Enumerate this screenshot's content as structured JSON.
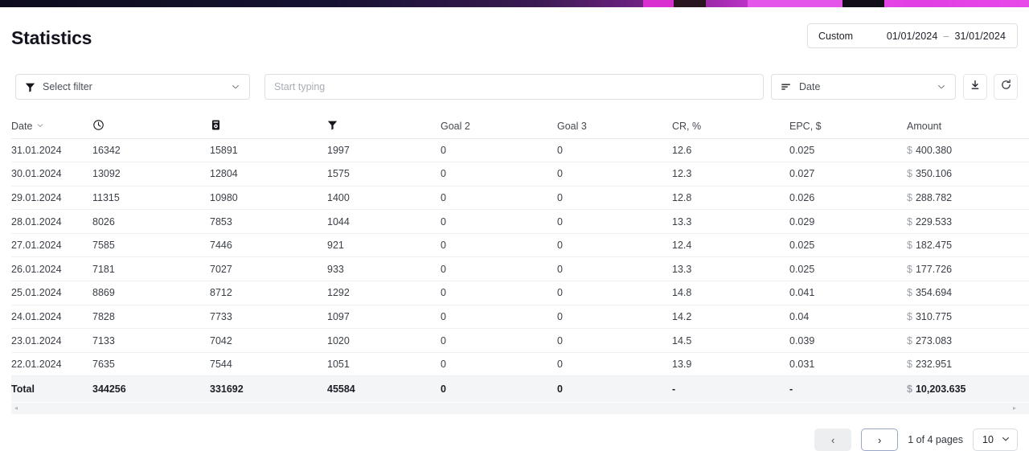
{
  "topbar": {
    "accent_dark": "#0d0c1d",
    "accent_magenta": "#e84ae8"
  },
  "header": {
    "title": "Statistics",
    "date_range": {
      "preset_label": "Custom",
      "start_date": "01/01/2024",
      "separator": "–",
      "end_date": "31/01/2024"
    }
  },
  "toolbar": {
    "filter_select": {
      "icon": "funnel-icon",
      "label": "Select filter",
      "caret": "chevron-down-icon"
    },
    "search": {
      "value": "",
      "placeholder": "Start typing"
    },
    "sort_select": {
      "icon": "sort-lines-icon",
      "label": "Date",
      "caret": "chevron-down-icon"
    },
    "export_button": {
      "icon": "download-icon"
    },
    "refresh_button": {
      "icon": "refresh-icon"
    }
  },
  "table": {
    "columns": [
      {
        "key": "date",
        "label": "Date",
        "icon": "",
        "sortable": true,
        "sort_caret": "⌄",
        "align": "left"
      },
      {
        "key": "clicks",
        "label": "",
        "icon": "clock-icon",
        "sortable": false,
        "align": "left"
      },
      {
        "key": "unique",
        "label": "",
        "icon": "document-eye-icon",
        "sortable": false,
        "align": "left"
      },
      {
        "key": "goal1",
        "label": "",
        "icon": "funnel-icon",
        "sortable": false,
        "align": "left"
      },
      {
        "key": "goal2",
        "label": "Goal 2",
        "icon": "",
        "sortable": false,
        "align": "left"
      },
      {
        "key": "goal3",
        "label": "Goal 3",
        "icon": "",
        "sortable": false,
        "align": "left"
      },
      {
        "key": "cr",
        "label": "CR, %",
        "icon": "",
        "sortable": false,
        "align": "left"
      },
      {
        "key": "epc",
        "label": "EPC, $",
        "icon": "",
        "sortable": false,
        "align": "left"
      },
      {
        "key": "amount",
        "label": "Amount",
        "icon": "",
        "sortable": false,
        "align": "left"
      }
    ],
    "rows": [
      {
        "date": "31.01.2024",
        "clicks": "16342",
        "unique": "15891",
        "goal1": "1997",
        "goal2": "0",
        "goal3": "0",
        "cr": "12.6",
        "epc": "0.025",
        "amount_currency": "$",
        "amount": "400.380"
      },
      {
        "date": "30.01.2024",
        "clicks": "13092",
        "unique": "12804",
        "goal1": "1575",
        "goal2": "0",
        "goal3": "0",
        "cr": "12.3",
        "epc": "0.027",
        "amount_currency": "$",
        "amount": "350.106"
      },
      {
        "date": "29.01.2024",
        "clicks": "11315",
        "unique": "10980",
        "goal1": "1400",
        "goal2": "0",
        "goal3": "0",
        "cr": "12.8",
        "epc": "0.026",
        "amount_currency": "$",
        "amount": "288.782"
      },
      {
        "date": "28.01.2024",
        "clicks": "8026",
        "unique": "7853",
        "goal1": "1044",
        "goal2": "0",
        "goal3": "0",
        "cr": "13.3",
        "epc": "0.029",
        "amount_currency": "$",
        "amount": "229.533"
      },
      {
        "date": "27.01.2024",
        "clicks": "7585",
        "unique": "7446",
        "goal1": "921",
        "goal2": "0",
        "goal3": "0",
        "cr": "12.4",
        "epc": "0.025",
        "amount_currency": "$",
        "amount": "182.475"
      },
      {
        "date": "26.01.2024",
        "clicks": "7181",
        "unique": "7027",
        "goal1": "933",
        "goal2": "0",
        "goal3": "0",
        "cr": "13.3",
        "epc": "0.025",
        "amount_currency": "$",
        "amount": "177.726"
      },
      {
        "date": "25.01.2024",
        "clicks": "8869",
        "unique": "8712",
        "goal1": "1292",
        "goal2": "0",
        "goal3": "0",
        "cr": "14.8",
        "epc": "0.041",
        "amount_currency": "$",
        "amount": "354.694"
      },
      {
        "date": "24.01.2024",
        "clicks": "7828",
        "unique": "7733",
        "goal1": "1097",
        "goal2": "0",
        "goal3": "0",
        "cr": "14.2",
        "epc": "0.04",
        "amount_currency": "$",
        "amount": "310.775"
      },
      {
        "date": "23.01.2024",
        "clicks": "7133",
        "unique": "7042",
        "goal1": "1020",
        "goal2": "0",
        "goal3": "0",
        "cr": "14.5",
        "epc": "0.039",
        "amount_currency": "$",
        "amount": "273.083"
      },
      {
        "date": "22.01.2024",
        "clicks": "7635",
        "unique": "7544",
        "goal1": "1051",
        "goal2": "0",
        "goal3": "0",
        "cr": "13.9",
        "epc": "0.031",
        "amount_currency": "$",
        "amount": "232.951"
      }
    ],
    "total_row": {
      "date": "Total",
      "clicks": "344256",
      "unique": "331692",
      "goal1": "45584",
      "goal2": "0",
      "goal3": "0",
      "cr": "-",
      "epc": "-",
      "amount_currency": "$",
      "amount": "10,203.635"
    }
  },
  "scrollbar": {
    "left_arrow": "◂",
    "right_arrow": "▸"
  },
  "pagination": {
    "prev_label": "‹",
    "next_label": "›",
    "page_label": "1 of 4 pages",
    "page_size": "10",
    "page_size_caret": "chevron-down-icon"
  }
}
